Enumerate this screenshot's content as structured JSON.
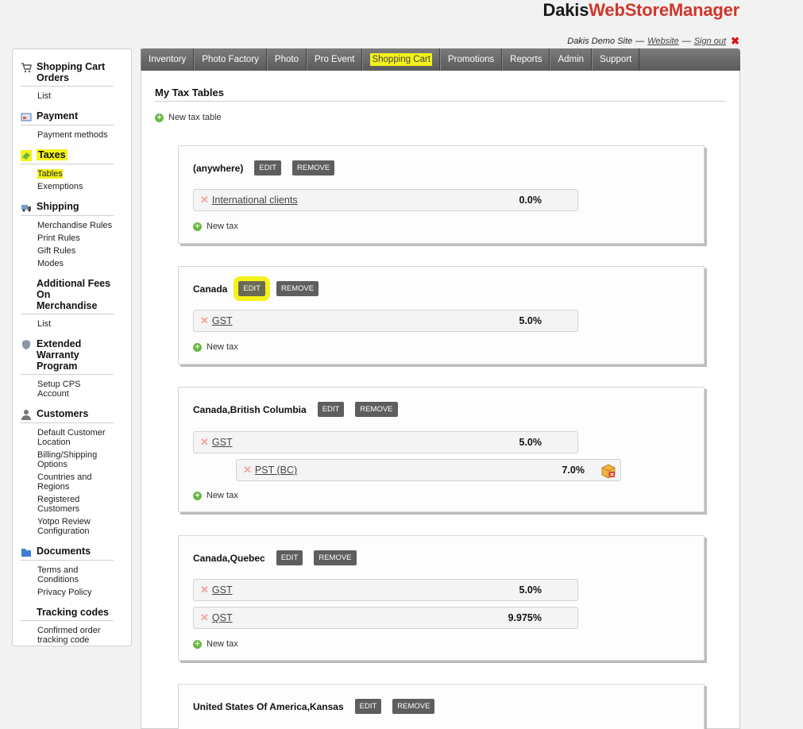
{
  "brand": {
    "part1": "Dakis",
    "part2": "WebStoreManager"
  },
  "siteline": {
    "site": "Dakis Demo Site",
    "sep1": "—",
    "website": "Website",
    "sep2": "—",
    "signout": "Sign out"
  },
  "nav": [
    "Inventory",
    "Photo Factory",
    "Photo",
    "Pro Event",
    "Shopping Cart",
    "Promotions",
    "Reports",
    "Admin",
    "Support"
  ],
  "sidebar": {
    "cart": {
      "title": "Shopping Cart Orders",
      "items": [
        "List"
      ]
    },
    "payment": {
      "title": "Payment",
      "items": [
        "Payment methods"
      ]
    },
    "taxes": {
      "title": "Taxes",
      "items": [
        "Tables",
        "Exemptions"
      ]
    },
    "shipping": {
      "title": "Shipping",
      "items": [
        "Merchandise Rules",
        "Print Rules",
        "Gift Rules",
        "Modes"
      ]
    },
    "fees": {
      "title": "Additional Fees On Merchandise",
      "items": [
        "List"
      ]
    },
    "warranty": {
      "title": "Extended Warranty Program",
      "items": [
        "Setup CPS Account"
      ]
    },
    "customers": {
      "title": "Customers",
      "items": [
        "Default Customer Location",
        "Billing/Shipping Options",
        "Countries and Regions",
        "Registered Customers",
        "Yotpo Review Configuration"
      ]
    },
    "documents": {
      "title": "Documents",
      "items": [
        "Terms and Conditions",
        "Privacy Policy"
      ]
    },
    "tracking": {
      "title": "Tracking codes",
      "items": [
        "Confirmed order tracking code"
      ]
    }
  },
  "main": {
    "title": "My Tax Tables",
    "new_table": "New tax table",
    "edit_label": "EDIT",
    "remove_label": "REMOVE",
    "new_tax": "New tax",
    "tables": [
      {
        "name": "(anywhere)",
        "taxes": [
          {
            "name": "International clients",
            "rate": "0.0%"
          }
        ]
      },
      {
        "name": "Canada",
        "taxes": [
          {
            "name": "GST",
            "rate": "5.0%"
          }
        ]
      },
      {
        "name": "Canada,British Columbia",
        "taxes": [
          {
            "name": "GST",
            "rate": "5.0%"
          },
          {
            "name": "PST (BC)",
            "rate": "7.0%"
          }
        ]
      },
      {
        "name": "Canada,Quebec",
        "taxes": [
          {
            "name": "GST",
            "rate": "5.0%"
          },
          {
            "name": "QST",
            "rate": "9.975%"
          }
        ]
      },
      {
        "name": "United States Of America,Kansas",
        "taxes": []
      }
    ]
  }
}
